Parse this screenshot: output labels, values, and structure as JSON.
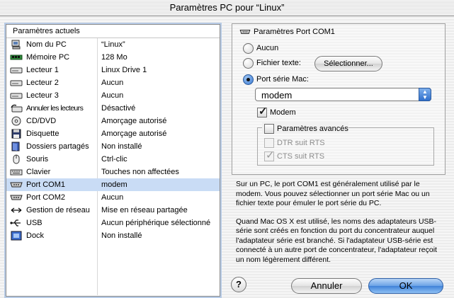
{
  "window": {
    "title": "Paramètres PC pour “Linux”"
  },
  "left": {
    "header": "Paramètres actuels",
    "rows": [
      {
        "label": "Nom du PC",
        "value": "“Linux”",
        "icon": "pc-icon"
      },
      {
        "label": "Mémoire PC",
        "value": "128 Mo",
        "icon": "memory-icon"
      },
      {
        "label": "Lecteur 1",
        "value": "Linux Drive 1",
        "icon": "drive-icon"
      },
      {
        "label": "Lecteur 2",
        "value": "Aucun",
        "icon": "drive-icon"
      },
      {
        "label": "Lecteur 3",
        "value": "Aucun",
        "icon": "drive-icon"
      },
      {
        "label": "Annuler les lecteurs",
        "value": "Désactivé",
        "icon": "undo-drives-icon"
      },
      {
        "label": "CD/DVD",
        "value": "Amorçage autorisé",
        "icon": "cd-icon"
      },
      {
        "label": "Disquette",
        "value": "Amorçage autorisé",
        "icon": "floppy-icon"
      },
      {
        "label": "Dossiers partagés",
        "value": "Non installé",
        "icon": "shared-folder-icon"
      },
      {
        "label": "Souris",
        "value": "Ctrl-clic",
        "icon": "mouse-icon"
      },
      {
        "label": "Clavier",
        "value": "Touches non affectées",
        "icon": "keyboard-icon"
      },
      {
        "label": "Port COM1",
        "value": "modem",
        "icon": "serial-port-icon"
      },
      {
        "label": "Port COM2",
        "value": "Aucun",
        "icon": "serial-port-icon"
      },
      {
        "label": "Gestion de réseau",
        "value": "Mise en réseau partagée",
        "icon": "network-icon"
      },
      {
        "label": "USB",
        "value": "Aucun périphérique sélectionné",
        "icon": "usb-icon"
      },
      {
        "label": "Dock",
        "value": "Non installé",
        "icon": "dock-icon"
      }
    ]
  },
  "settings": {
    "group_title": "Paramètres Port COM1",
    "opt_none": "Aucun",
    "opt_text": "Fichier texte:",
    "select_button": "Sélectionner...",
    "opt_serial": "Port série Mac:",
    "serial_value": "modem",
    "modem_check": "Modem",
    "advanced": "Paramètres avancés",
    "dtr": "DTR suit RTS",
    "cts": "CTS suit RTS"
  },
  "help": {
    "p1": "Sur un PC, le port COM1 est généralement utilisé par le modem. Vous pouvez sélectionner un port série Mac ou un fichier texte pour émuler le port série du PC.",
    "p2": "Quand Mac OS X est utilisé, les noms des adaptateurs USB-série sont créés en fonction du port du concentrateur auquel l'adaptateur série est branché. Si l'adaptateur USB-série est connecté à un autre port de concentrateur, l'adaptateur reçoit un nom légèrement différent."
  },
  "buttons": {
    "help": "?",
    "cancel": "Annuler",
    "ok": "OK"
  },
  "colors": {
    "selection": "#c9dcf5",
    "accent": "#3f82d8"
  }
}
